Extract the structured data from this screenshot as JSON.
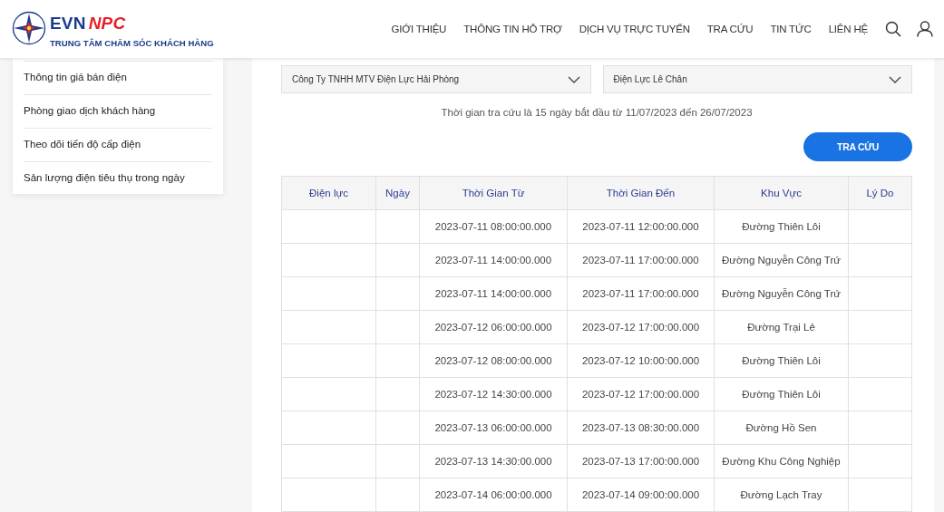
{
  "header": {
    "brand": {
      "part_1": "EVN",
      "part_2": "NPC",
      "tagline": "TRUNG TÂM CHĂM SÓC KHÁCH HÀNG"
    },
    "nav": [
      "GIỚI THIỆU",
      "THÔNG TIN HỖ TRỢ",
      "DỊCH VỤ TRỰC TUYẾN",
      "TRA CỨU",
      "TIN TỨC",
      "LIÊN HỆ"
    ]
  },
  "sidebar": {
    "items": [
      "Thông tin giá bán điện",
      "Phòng giao dịch khách hàng",
      "Theo dõi tiến độ cấp điện",
      "Sản lượng điện tiêu thụ trong ngày"
    ]
  },
  "filters": {
    "company": "Công Ty TNHH MTV Điện Lực Hải Phòng",
    "branch": "Điện Lực Lê Chân"
  },
  "note": "Thời gian tra cứu là 15 ngày bắt đầu từ 11/07/2023 đến 26/07/2023",
  "search_button": "TRA CỨU",
  "table": {
    "columns": [
      "Điện lực",
      "Ngày",
      "Thời Gian Từ",
      "Thời Gian Đến",
      "Khu Vực",
      "Lý Do"
    ],
    "rows": [
      {
        "from": "2023-07-11 08:00:00.000",
        "to": "2023-07-11 12:00:00.000",
        "area": "Đường Thiên Lôi"
      },
      {
        "from": "2023-07-11 14:00:00.000",
        "to": "2023-07-11 17:00:00.000",
        "area": "Đường Nguyễn Công Trứ"
      },
      {
        "from": "2023-07-11 14:00:00.000",
        "to": "2023-07-11 17:00:00.000",
        "area": "Đường Nguyễn Công Trứ"
      },
      {
        "from": "2023-07-12 06:00:00.000",
        "to": "2023-07-12 17:00:00.000",
        "area": "Đường Trại Lẻ"
      },
      {
        "from": "2023-07-12 08:00:00.000",
        "to": "2023-07-12 10:00:00.000",
        "area": "Đường Thiên Lôi"
      },
      {
        "from": "2023-07-12 14:30:00.000",
        "to": "2023-07-12 17:00:00.000",
        "area": "Đường Thiên Lôi"
      },
      {
        "from": "2023-07-13 06:00:00.000",
        "to": "2023-07-13 08:30:00.000",
        "area": "Đường Hồ Sen"
      },
      {
        "from": "2023-07-13 14:30:00.000",
        "to": "2023-07-13 17:00:00.000",
        "area": "Đường Khu Công Nghiệp"
      },
      {
        "from": "2023-07-14 06:00:00.000",
        "to": "2023-07-14 09:00:00.000",
        "area": "Đường Lạch Tray"
      }
    ]
  }
}
